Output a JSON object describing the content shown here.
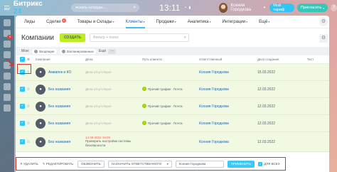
{
  "header": {
    "logo_text": "Битрикс",
    "logo_num": "24",
    "search_placeholder": "искать сотрудн...",
    "clock": "13:11",
    "user_name": "Ксения Городкова",
    "tariff_label": "Мой тариф",
    "invite_label": "Пригласить",
    "help": "?"
  },
  "sidebar": {
    "badge": "5"
  },
  "menu": {
    "items": [
      {
        "label": "Лиды",
        "count": ""
      },
      {
        "label": "Сделки",
        "count": "4"
      },
      {
        "label": "Товары и Склады",
        "count": ""
      },
      {
        "label": "Клиенты",
        "count": ""
      },
      {
        "label": "Продажи",
        "count": ""
      },
      {
        "label": "Аналитика",
        "count": ""
      },
      {
        "label": "Интеграции",
        "count": ""
      },
      {
        "label": "Ещё",
        "count": ""
      }
    ]
  },
  "toolbar": {
    "title": "Компании",
    "create_label": "СОЗДАТЬ",
    "filter_placeholder": "Фильтр + поиск"
  },
  "counters": {
    "label": "Мои:",
    "items": [
      {
        "label": "Входящие",
        "color": "#9aa0a7"
      },
      {
        "label": "Запланированные",
        "color": "#9aa0a7"
      }
    ],
    "more_label": "Ещё"
  },
  "grid": {
    "columns": [
      "Компания",
      "Дела",
      "Путь клиента",
      "Ответственный",
      "Дата создания",
      "Тест"
    ],
    "rows": [
      {
        "company": "Амиапок и КО",
        "deal": "Дела отсутствуют",
        "deal_date": "",
        "path": "",
        "responsible": "Ксения Городкова",
        "date": "15.03.2022"
      },
      {
        "company": "Без названия",
        "deal": "Дела отсутствуют",
        "deal_date": "",
        "path": "Прочий трафик · Почта",
        "responsible": "Ксения Городкова",
        "date": "12.03.2022"
      },
      {
        "company": "Без названия",
        "deal": "Дела отсутствуют",
        "deal_date": "",
        "path": "Прочий трафик · Почта",
        "responsible": "Ксения Городкова",
        "date": "12.03.2022"
      },
      {
        "company": "Без названия",
        "deal": "Дела отсутствуют",
        "deal_date": "",
        "path": "Прочий трафик · Почта",
        "responsible": "Ксения Городкова",
        "date": "12.03.2022"
      },
      {
        "company": "Без названия",
        "deal": "Проверить настройки системы безопасности",
        "deal_date": "14.09.2022 19:00",
        "path": "",
        "responsible": "Ксения Городкова",
        "date": "12.03.2022"
      }
    ]
  },
  "actionbar": {
    "delete_label": "УДАЛИТЬ",
    "edit_label": "РЕДАКТИРОВАТЬ",
    "call_label": "ОБЗВОНИТЬ",
    "assign_label": "НАЗНАЧИТЬ ОТВЕТСТВЕННОГО",
    "assign_value": "Ксения Городкова",
    "apply_label": "ПРИМЕНИТЬ",
    "all_label": "ДЛЯ ВСЕХ"
  }
}
